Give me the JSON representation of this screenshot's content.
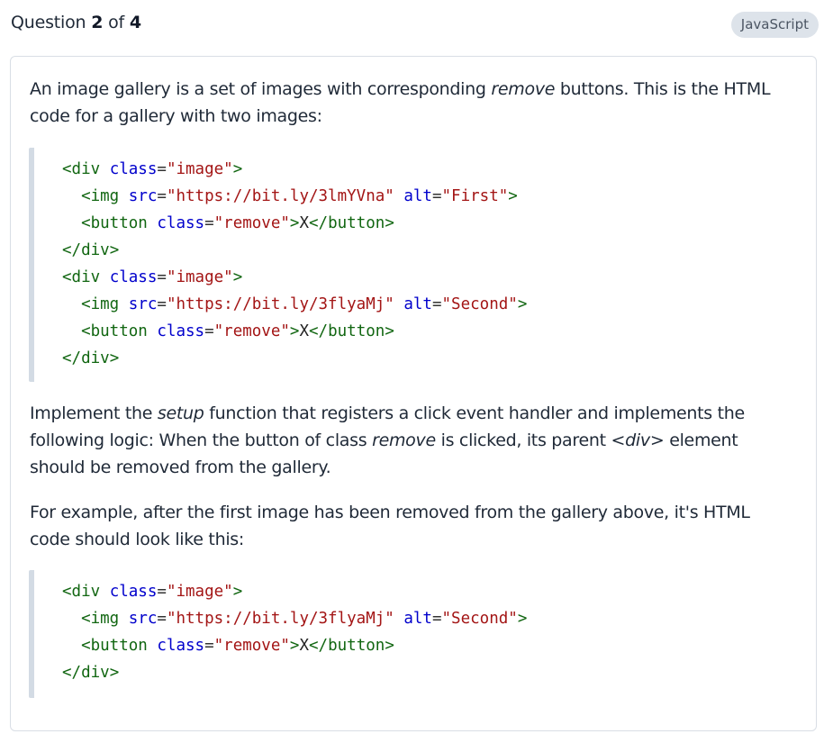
{
  "header": {
    "question_prefix": "Question ",
    "question_number": "2",
    "question_of": " of ",
    "question_total": "4",
    "language_badge": "JavaScript"
  },
  "question": {
    "p1_text_a": "An image gallery is a set of images with corresponding ",
    "p1_em": "remove",
    "p1_text_b": " buttons. This is the HTML code for a gallery with two images:",
    "p2_text_a": "Implement the ",
    "p2_em_a": "setup",
    "p2_text_b": " function that registers a click event handler and implements the following logic: When the button of class ",
    "p2_em_b": "remove",
    "p2_text_c": " is clicked, its parent ",
    "p2_em_c": "<div>",
    "p2_text_d": " element should be removed from the gallery.",
    "p3_text": "For example, after the first image has been removed from the gallery above, it's HTML code should look like this:"
  },
  "code_blocks": [
    {
      "lines": [
        "<div class=\"image\">",
        "  <img src=\"https://bit.ly/3lmYVna\" alt=\"First\">",
        "  <button class=\"remove\">X</button>",
        "</div>",
        "<div class=\"image\">",
        "  <img src=\"https://bit.ly/3flyaMj\" alt=\"Second\">",
        "  <button class=\"remove\">X</button>",
        "</div>"
      ]
    },
    {
      "lines": [
        "<div class=\"image\">",
        "  <img src=\"https://bit.ly/3flyaMj\" alt=\"Second\">",
        "  <button class=\"remove\">X</button>",
        "</div>"
      ]
    }
  ],
  "colors": {
    "tag": "#116611",
    "attribute": "#0000cc",
    "string": "#a31515",
    "badge_bg": "#dde3ea",
    "quote_bar": "#d3dbe4"
  }
}
